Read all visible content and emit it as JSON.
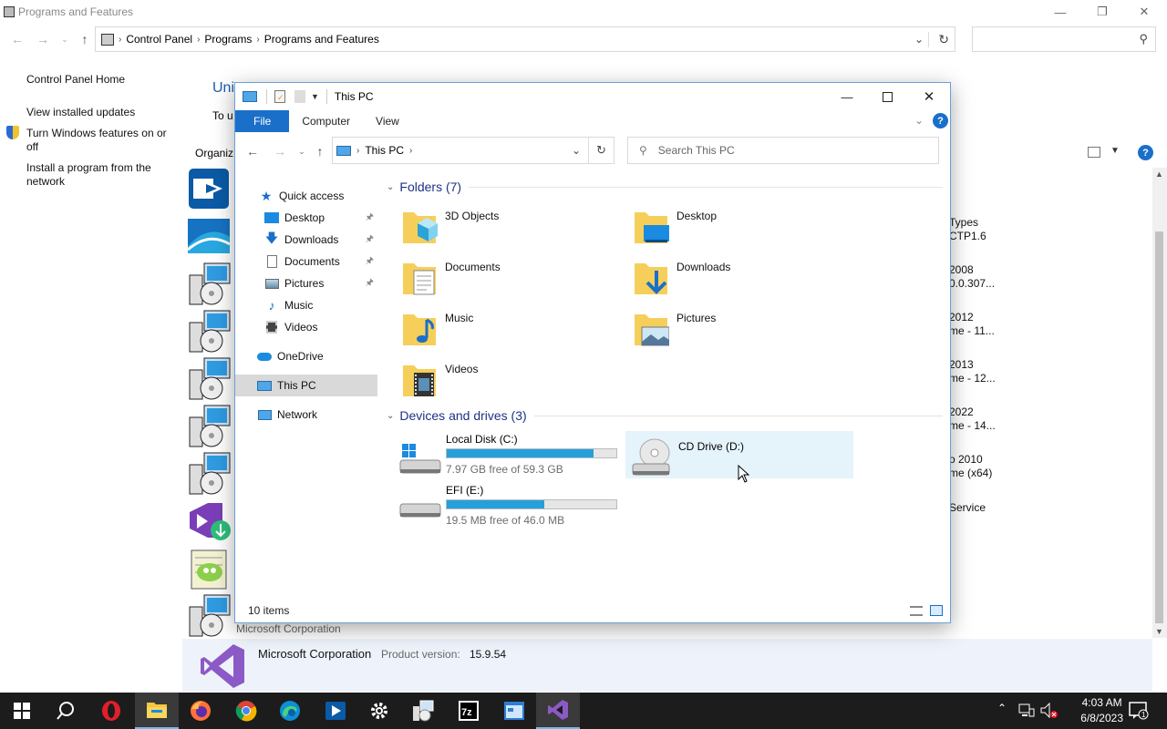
{
  "background_window": {
    "title": "Programs and Features",
    "breadcrumb": [
      "Control Panel",
      "Programs",
      "Programs and Features"
    ],
    "sidebar": {
      "home": "Control Panel Home",
      "view_updates": "View installed updates",
      "turn_features": "Turn Windows features on or off",
      "install_network": "Install a program from the network"
    },
    "heading_fragment": "Uni",
    "desc_fragment": "To u",
    "organize_fragment": "Organiz",
    "right_fragments": [
      "Types",
      "CTP1.6",
      "2008",
      "0.0.307...",
      "2012",
      "me - 11...",
      "2013",
      "me - 12...",
      "2022",
      "me - 14...",
      "o 2010",
      "me (x64)",
      "Service"
    ],
    "publisher_row": "Microsoft Corporation",
    "details": {
      "publisher": "Microsoft Corporation",
      "product_version_label": "Product version:",
      "product_version": "15.9.54"
    }
  },
  "explorer": {
    "title": "This PC",
    "ribbon_tabs": [
      "File",
      "Computer",
      "View"
    ],
    "address": "This PC",
    "search_placeholder": "Search This PC",
    "nav": {
      "quick_access": "Quick access",
      "desktop": "Desktop",
      "downloads": "Downloads",
      "documents": "Documents",
      "pictures": "Pictures",
      "music": "Music",
      "videos": "Videos",
      "onedrive": "OneDrive",
      "this_pc": "This PC",
      "network": "Network"
    },
    "folders_header": "Folders (7)",
    "folders": [
      "3D Objects",
      "Desktop",
      "Documents",
      "Downloads",
      "Music",
      "Pictures",
      "Videos"
    ],
    "drives_header": "Devices and drives (3)",
    "drives": [
      {
        "name": "Local Disk (C:)",
        "free": "7.97 GB free of 59.3 GB",
        "used_fraction": 0.866
      },
      {
        "name": "CD Drive (D:)"
      },
      {
        "name": "EFI (E:)",
        "free": "19.5 MB free of 46.0 MB",
        "used_fraction": 0.576
      }
    ],
    "status": "10 items"
  },
  "taskbar": {
    "time": "4:03 AM",
    "date": "6/8/2023",
    "apps": [
      "start",
      "search",
      "opera",
      "file-explorer",
      "firefox",
      "chrome",
      "edge",
      "remote-desktop",
      "settings",
      "programs-features",
      "7zip",
      "app-window",
      "visual-studio-installer"
    ]
  },
  "colors": {
    "accent": "#1a6fc9",
    "progress": "#26a0da",
    "section_heading": "#1e3287",
    "taskbar": "#1c1c1c",
    "link_blue": "#1c5fae"
  }
}
